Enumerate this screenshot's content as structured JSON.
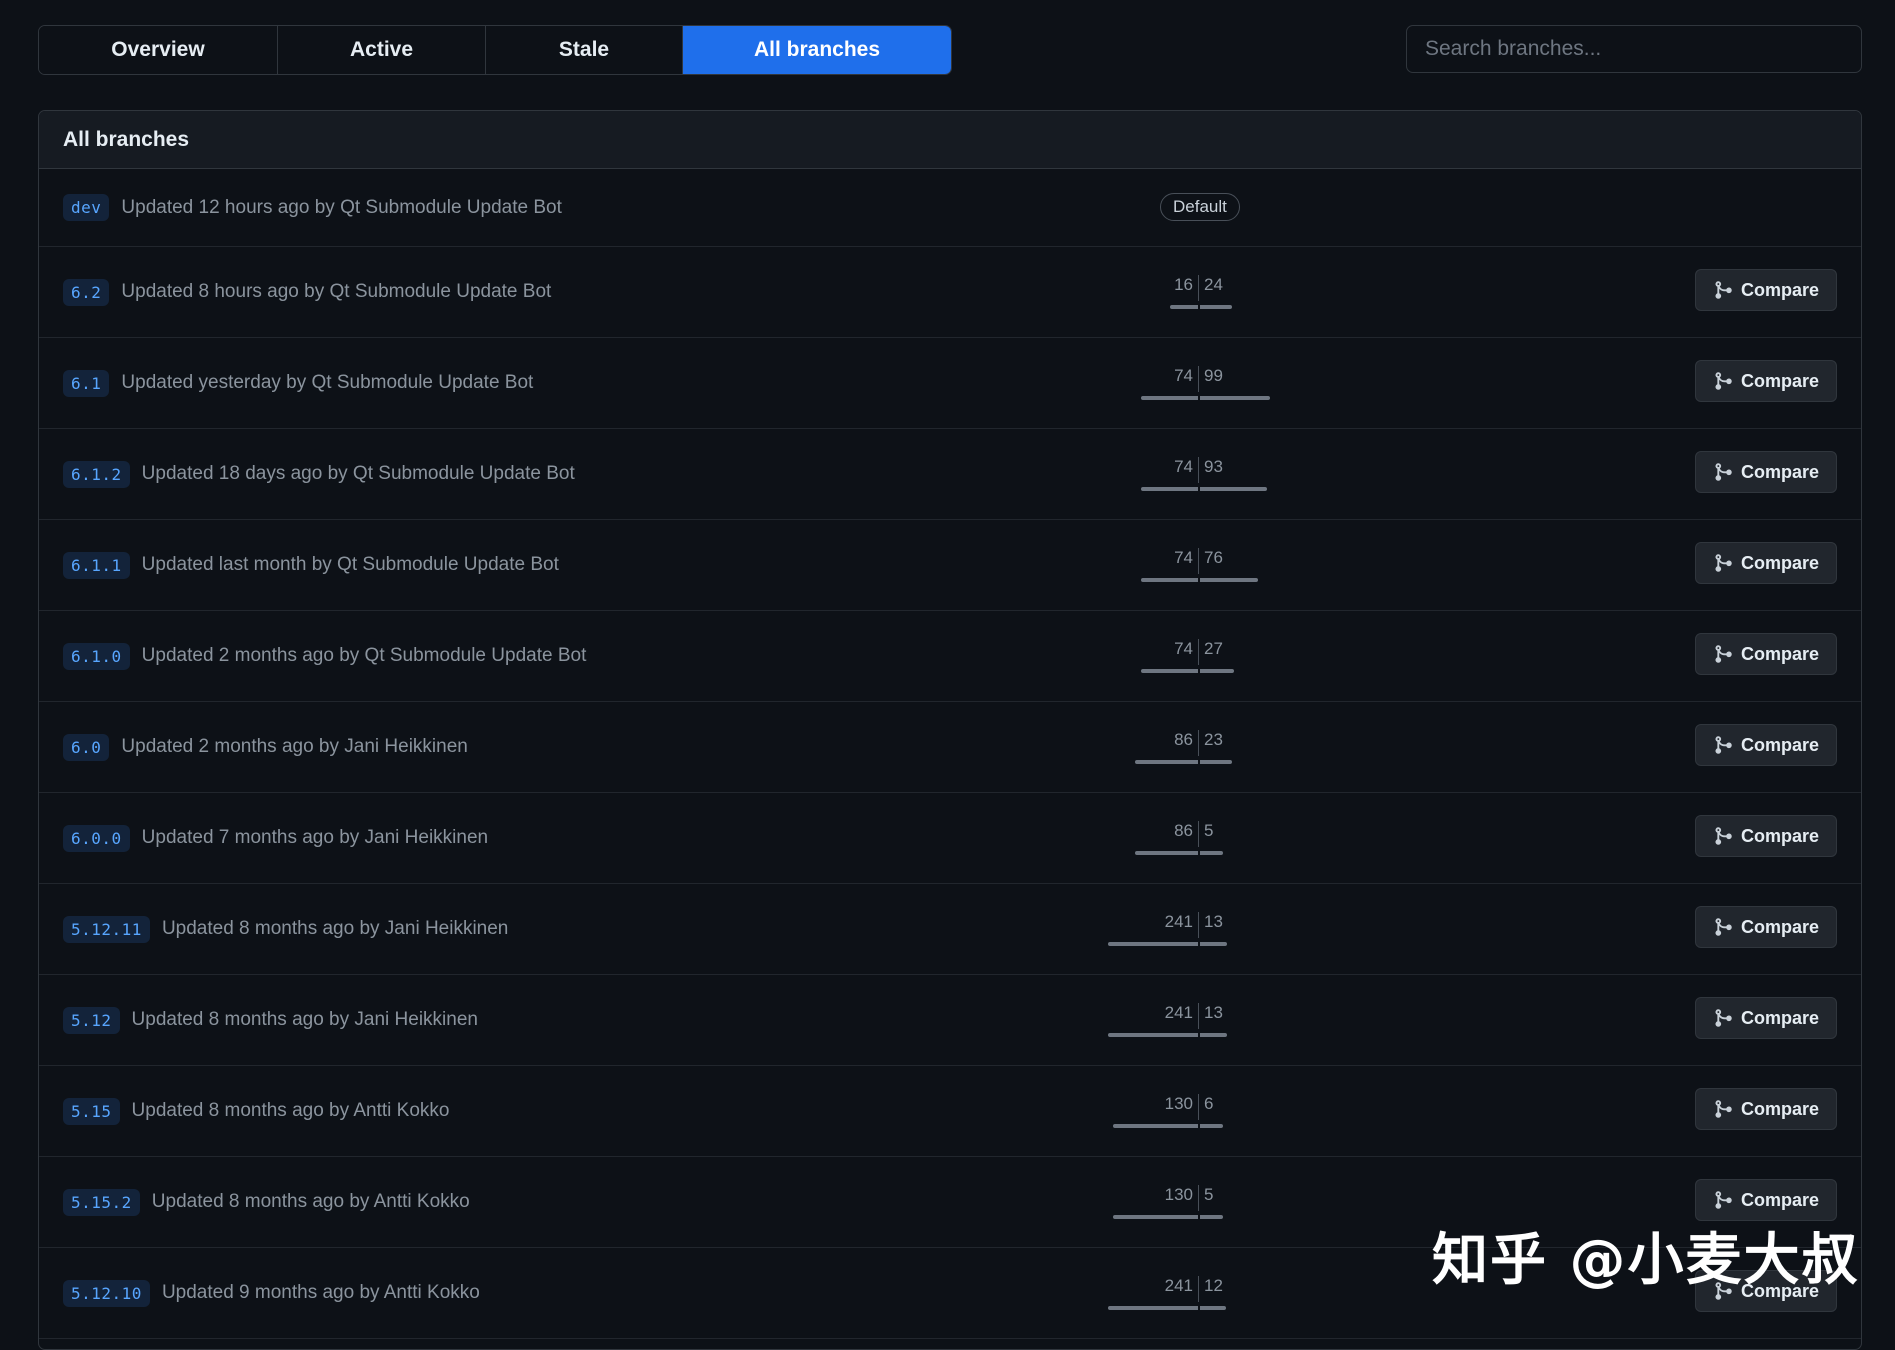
{
  "tabs": [
    {
      "label": "Overview",
      "active": false
    },
    {
      "label": "Active",
      "active": false
    },
    {
      "label": "Stale",
      "active": false
    },
    {
      "label": "All branches",
      "active": true
    }
  ],
  "search": {
    "placeholder": "Search branches..."
  },
  "section_title": "All branches",
  "default_badge": "Default",
  "compare_label": "Compare",
  "branches": [
    {
      "name": "dev",
      "meta": "Updated 12 hours ago by Qt Submodule Update Bot",
      "default": true
    },
    {
      "name": "6.2",
      "meta": "Updated 8 hours ago by Qt Submodule Update Bot",
      "behind": 16,
      "ahead": 24
    },
    {
      "name": "6.1",
      "meta": "Updated yesterday by Qt Submodule Update Bot",
      "behind": 74,
      "ahead": 99
    },
    {
      "name": "6.1.2",
      "meta": "Updated 18 days ago by Qt Submodule Update Bot",
      "behind": 74,
      "ahead": 93
    },
    {
      "name": "6.1.1",
      "meta": "Updated last month by Qt Submodule Update Bot",
      "behind": 74,
      "ahead": 76
    },
    {
      "name": "6.1.0",
      "meta": "Updated 2 months ago by Qt Submodule Update Bot",
      "behind": 74,
      "ahead": 27
    },
    {
      "name": "6.0",
      "meta": "Updated 2 months ago by Jani Heikkinen",
      "behind": 86,
      "ahead": 23
    },
    {
      "name": "6.0.0",
      "meta": "Updated 7 months ago by Jani Heikkinen",
      "behind": 86,
      "ahead": 5
    },
    {
      "name": "5.12.11",
      "meta": "Updated 8 months ago by Jani Heikkinen",
      "behind": 241,
      "ahead": 13
    },
    {
      "name": "5.12",
      "meta": "Updated 8 months ago by Jani Heikkinen",
      "behind": 241,
      "ahead": 13
    },
    {
      "name": "5.15",
      "meta": "Updated 8 months ago by Antti Kokko",
      "behind": 130,
      "ahead": 6
    },
    {
      "name": "5.15.2",
      "meta": "Updated 8 months ago by Antti Kokko",
      "behind": 130,
      "ahead": 5
    },
    {
      "name": "5.12.10",
      "meta": "Updated 9 months ago by Antti Kokko",
      "behind": 241,
      "ahead": 12
    }
  ],
  "watermark": "知乎 @小麦大叔"
}
